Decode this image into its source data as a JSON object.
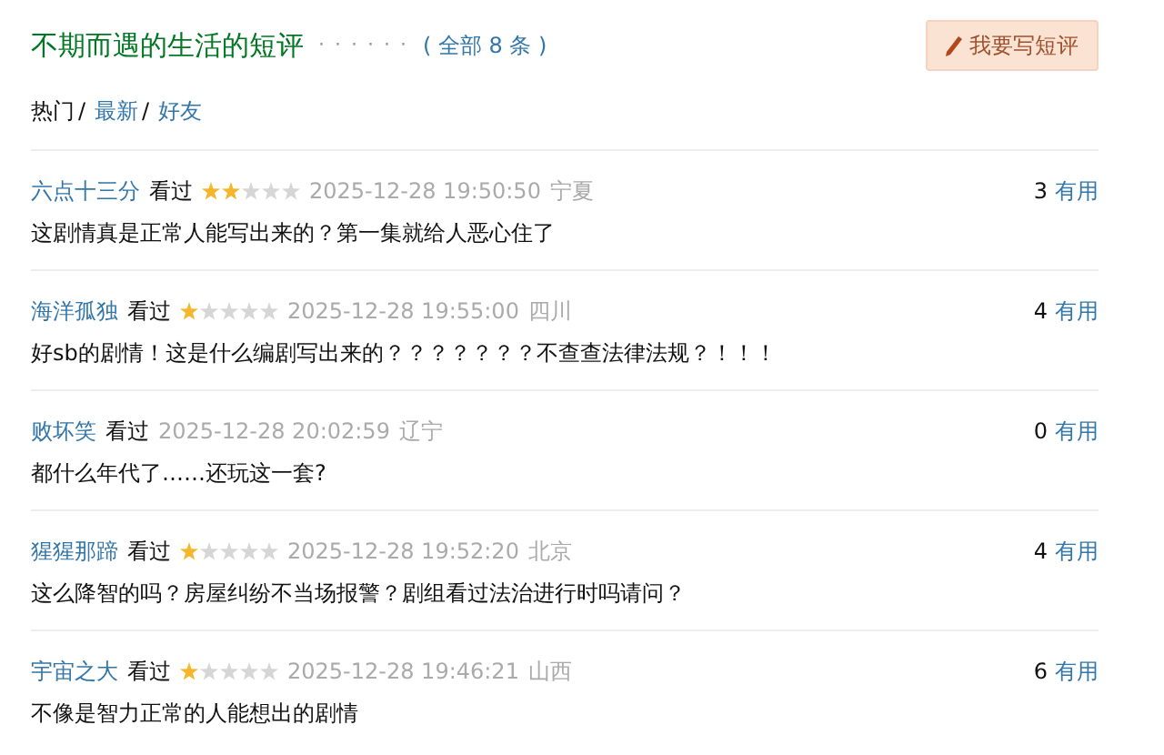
{
  "header": {
    "title": "不期而遇的生活的短评",
    "dots": "· · · · · ·",
    "count": "( 全部 8 条 )",
    "write_button": "我要写短评"
  },
  "sort_tabs": [
    {
      "label": "热门",
      "selected": true,
      "sep": "/"
    },
    {
      "label": "最新",
      "selected": false,
      "sep": "/"
    },
    {
      "label": "好友",
      "selected": false
    }
  ],
  "comments": [
    {
      "user": "六点十三分",
      "status": "看过",
      "stars": 2,
      "time": "2025-12-28 19:50:50",
      "region": "宁夏",
      "votes": "3",
      "useful": "有用",
      "text": "这剧情真是正常人能写出来的？第一集就给人恶心住了"
    },
    {
      "user": "海洋孤独",
      "status": "看过",
      "stars": 1,
      "time": "2025-12-28 19:55:00",
      "region": "四川",
      "votes": "4",
      "useful": "有用",
      "text": "好sb的剧情！这是什么编剧写出来的？？？？？？？不查查法律法规？！！！"
    },
    {
      "user": "败坏笑",
      "status": "看过",
      "time": "2025-12-28 20:02:59",
      "region": "辽宁",
      "votes": "0",
      "useful": "有用",
      "text": "都什么年代了……还玩这一套?"
    },
    {
      "user": "猩猩那蹄",
      "status": "看过",
      "stars": 1,
      "time": "2025-12-28 19:52:20",
      "region": "北京",
      "votes": "4",
      "useful": "有用",
      "text": "这么降智的吗？房屋纠纷不当场报警？剧组看过法治进行时吗请问？"
    },
    {
      "user": "宇宙之大",
      "status": "看过",
      "stars": 1,
      "time": "2025-12-28 19:46:21",
      "region": "山西",
      "votes": "6",
      "useful": "有用",
      "text": "不像是智力正常的人能想出的剧情"
    }
  ]
}
